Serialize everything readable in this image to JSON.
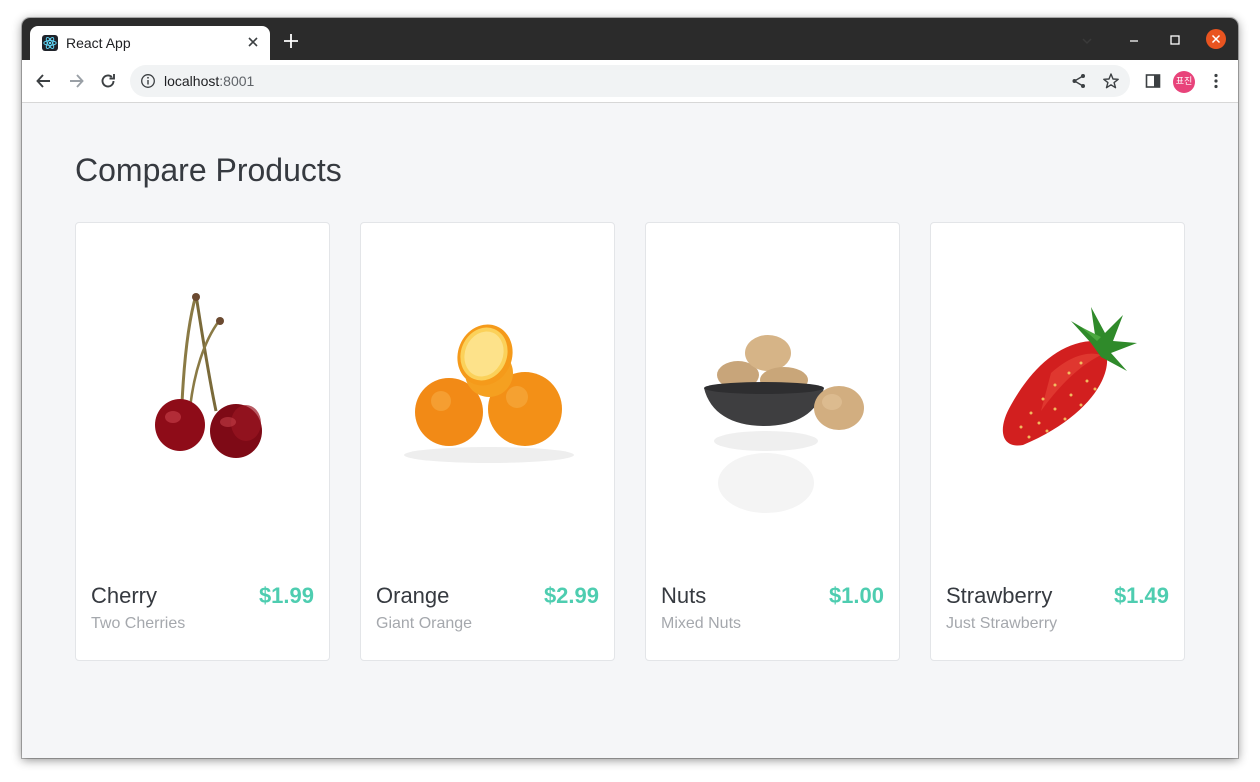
{
  "browser": {
    "tab_title": "React App",
    "url_host": "localhost",
    "url_port": ":8001",
    "profile_initials": "표진"
  },
  "page": {
    "title": "Compare Products"
  },
  "products": [
    {
      "name": "Cherry",
      "price": "$1.99",
      "description": "Two Cherries",
      "image_icon": "cherry-image"
    },
    {
      "name": "Orange",
      "price": "$2.99",
      "description": "Giant Orange",
      "image_icon": "orange-image"
    },
    {
      "name": "Nuts",
      "price": "$1.00",
      "description": "Mixed Nuts",
      "image_icon": "nuts-image"
    },
    {
      "name": "Strawberry",
      "price": "$1.49",
      "description": "Just Strawberry",
      "image_icon": "strawberry-image"
    }
  ],
  "colors": {
    "price": "#4ecdb0",
    "title": "#363a40",
    "description": "#a5a8ad",
    "page_bg": "#f5f6f8",
    "chrome_close": "#e95420",
    "avatar": "#e8437a"
  }
}
